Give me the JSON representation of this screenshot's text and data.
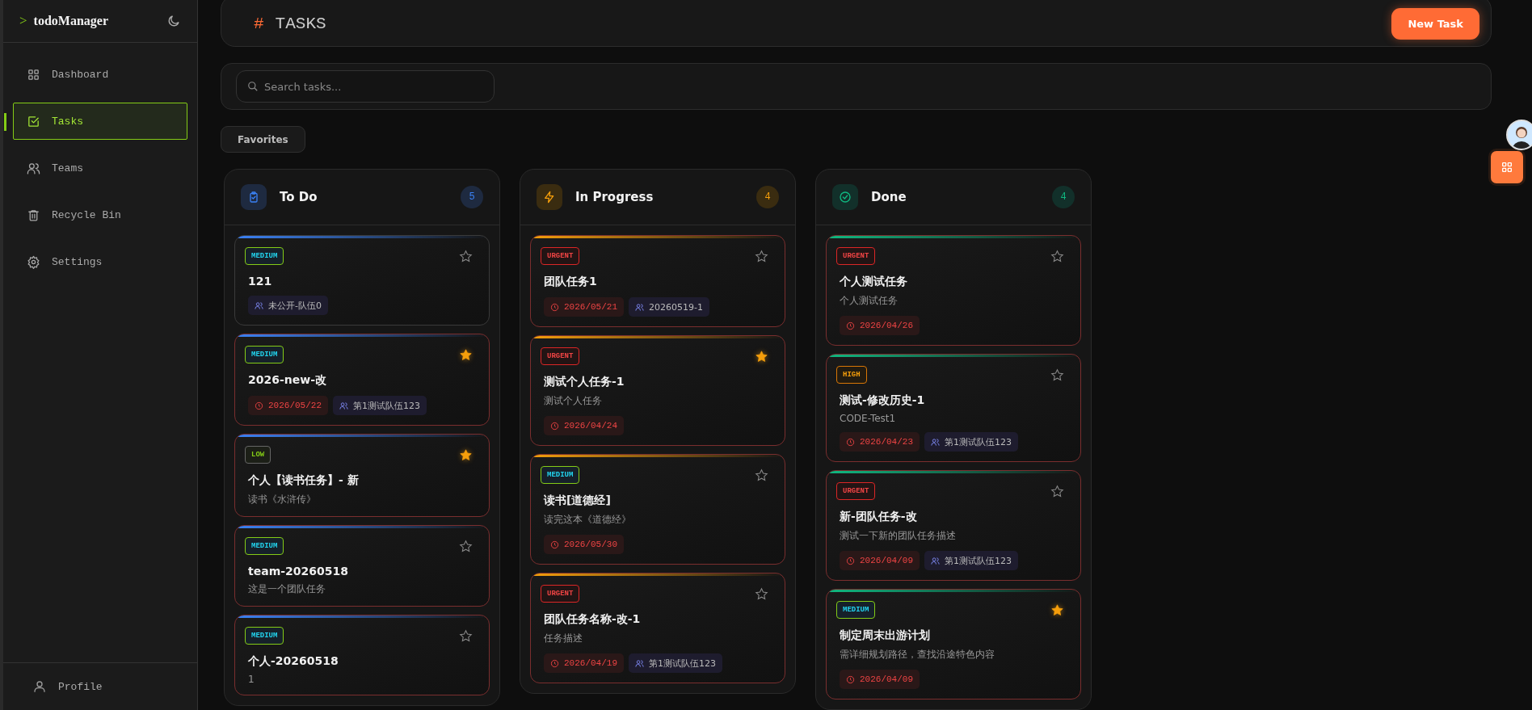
{
  "sidebar": {
    "logo_mark": ">",
    "app_name": "todoManager",
    "items": [
      {
        "label": "Dashboard",
        "kind": "grid",
        "selected": false
      },
      {
        "label": "Tasks",
        "kind": "check",
        "selected": true
      },
      {
        "label": "Teams",
        "kind": "users",
        "selected": false
      },
      {
        "label": "Recycle Bin",
        "kind": "trash",
        "selected": false
      },
      {
        "label": "Settings",
        "kind": "gear",
        "selected": false
      }
    ],
    "profile": {
      "label": "Profile"
    }
  },
  "header": {
    "hash": "#",
    "title": "TASKS",
    "new_task_button": "New Task"
  },
  "search": {
    "placeholder": "Search tasks..."
  },
  "favorites_button": "Favorites",
  "columns": [
    {
      "kind": "todo",
      "title": "To Do",
      "count": "5",
      "cards": [
        {
          "kind": "medium",
          "priority_label": "MEDIUM",
          "starred": false,
          "overdue": false,
          "title": "121",
          "team": "未公开-队伍0"
        },
        {
          "kind": "medium",
          "priority_label": "MEDIUM",
          "starred": true,
          "overdue": true,
          "title": "2026-new-改",
          "due": "2026/05/22",
          "team": "第1测试队伍123"
        },
        {
          "kind": "low",
          "priority_label": "LOW",
          "starred": true,
          "overdue": true,
          "title": "个人【读书任务】- 新",
          "description": "读书《水浒传》"
        },
        {
          "kind": "medium",
          "priority_label": "MEDIUM",
          "starred": false,
          "overdue": true,
          "title": "team-20260518",
          "description": "这是一个团队任务"
        },
        {
          "kind": "medium",
          "priority_label": "MEDIUM",
          "starred": false,
          "overdue": true,
          "title": "个人-20260518",
          "description": "1"
        }
      ]
    },
    {
      "kind": "progress",
      "title": "In Progress",
      "count": "4",
      "cards": [
        {
          "kind": "urgent",
          "priority_label": "URGENT",
          "starred": false,
          "overdue": true,
          "title": "团队任务1",
          "due": "2026/05/21",
          "team": "20260519-1"
        },
        {
          "kind": "urgent",
          "priority_label": "URGENT",
          "starred": true,
          "overdue": true,
          "title": "测试个人任务-1",
          "description": "测试个人任务",
          "due": "2026/04/24"
        },
        {
          "kind": "medium",
          "priority_label": "MEDIUM",
          "starred": false,
          "overdue": true,
          "title": "读书[道德经]",
          "description": "读完这本《道德经》",
          "due": "2026/05/30"
        },
        {
          "kind": "urgent",
          "priority_label": "URGENT",
          "starred": false,
          "overdue": true,
          "title": "团队任务名称-改-1",
          "description": "任务描述",
          "due": "2026/04/19",
          "team": "第1测试队伍123"
        }
      ]
    },
    {
      "kind": "done",
      "title": "Done",
      "count": "4",
      "cards": [
        {
          "kind": "urgent",
          "priority_label": "URGENT",
          "starred": false,
          "overdue": true,
          "title": "个人测试任务",
          "description": "个人测试任务",
          "due": "2026/04/26"
        },
        {
          "kind": "high",
          "priority_label": "HIGH",
          "starred": false,
          "overdue": true,
          "title": "测试-修改历史-1",
          "description": "CODE-Test1",
          "due": "2026/04/23",
          "team": "第1测试队伍123"
        },
        {
          "kind": "urgent",
          "priority_label": "URGENT",
          "starred": false,
          "overdue": true,
          "title": "新-团队任务-改",
          "description": "测试一下新的团队任务描述",
          "due": "2026/04/09",
          "team": "第1测试队伍123"
        },
        {
          "kind": "medium",
          "priority_label": "MEDIUM",
          "starred": true,
          "overdue": true,
          "title": "制定周末出游计划",
          "description": "需详细规划路径，查找沿途特色内容",
          "due": "2026/04/09"
        }
      ]
    }
  ]
}
